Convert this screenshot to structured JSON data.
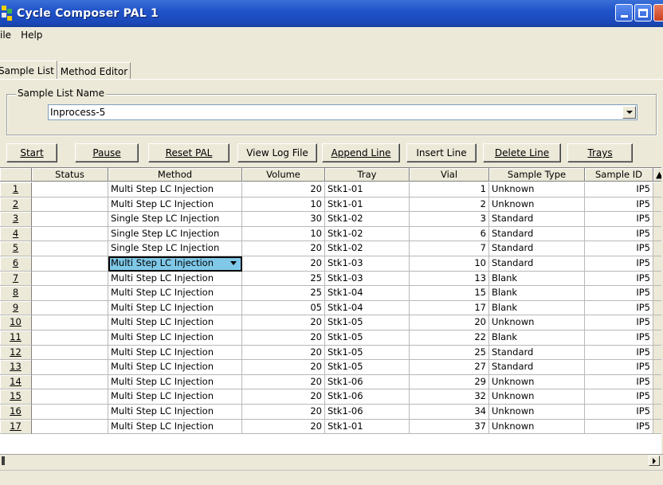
{
  "window": {
    "title": "Cycle Composer  PAL 1"
  },
  "menu": [
    "ile",
    "Help"
  ],
  "tabs": [
    {
      "label": "Sample List",
      "active": true
    },
    {
      "label": "Method Editor",
      "active": false
    }
  ],
  "sample_list_name": {
    "legend": "Sample List Name",
    "value": "Inprocess-5"
  },
  "toolbar": {
    "start": "Start",
    "pause": "Pause",
    "reset": "Reset PAL",
    "view_log": "View Log File",
    "append": "Append Line",
    "insert": "Insert Line",
    "delete": "Delete Line",
    "trays": "Trays"
  },
  "columns": [
    "Status",
    "Method",
    "Volume",
    "Tray",
    "Vial",
    "Sample Type",
    "Sample ID"
  ],
  "rows": [
    {
      "n": "1",
      "status": "",
      "method": "Multi Step LC Injection",
      "volume": "20",
      "tray": "Stk1-01",
      "vial": "1",
      "type": "Unknown",
      "sid": "IP5"
    },
    {
      "n": "2",
      "status": "",
      "method": "Multi Step LC Injection",
      "volume": "10",
      "tray": "Stk1-01",
      "vial": "2",
      "type": "Unknown",
      "sid": "IP5"
    },
    {
      "n": "3",
      "status": "",
      "method": "Single Step LC Injection",
      "volume": "30",
      "tray": "Stk1-02",
      "vial": "3",
      "type": "Standard",
      "sid": "IP5"
    },
    {
      "n": "4",
      "status": "",
      "method": "Single Step LC Injection",
      "volume": "10",
      "tray": "Stk1-02",
      "vial": "6",
      "type": "Standard",
      "sid": "IP5"
    },
    {
      "n": "5",
      "status": "",
      "method": "Single Step LC Injection",
      "volume": "20",
      "tray": "Stk1-02",
      "vial": "7",
      "type": "Standard",
      "sid": "IP5"
    },
    {
      "n": "6",
      "status": "",
      "method": "Multi Step LC Injection",
      "volume": "20",
      "tray": "Stk1-03",
      "vial": "10",
      "type": "Standard",
      "sid": "IP5",
      "editing": true
    },
    {
      "n": "7",
      "status": "",
      "method": "Multi Step LC Injection",
      "volume": "25",
      "tray": "Stk1-03",
      "vial": "13",
      "type": "Blank",
      "sid": "IP5"
    },
    {
      "n": "8",
      "status": "",
      "method": "Multi Step LC Injection",
      "volume": "25",
      "tray": "Stk1-04",
      "vial": "15",
      "type": "Blank",
      "sid": "IP5"
    },
    {
      "n": "9",
      "status": "",
      "method": "Multi Step LC Injection",
      "volume": "05",
      "tray": "Stk1-04",
      "vial": "17",
      "type": "Blank",
      "sid": "IP5"
    },
    {
      "n": "10",
      "status": "",
      "method": "Multi Step LC Injection",
      "volume": "20",
      "tray": "Stk1-05",
      "vial": "20",
      "type": "Unknown",
      "sid": "IP5"
    },
    {
      "n": "11",
      "status": "",
      "method": "Multi Step LC Injection",
      "volume": "20",
      "tray": "Stk1-05",
      "vial": "22",
      "type": "Blank",
      "sid": "IP5"
    },
    {
      "n": "12",
      "status": "",
      "method": "Multi Step LC Injection",
      "volume": "20",
      "tray": "Stk1-05",
      "vial": "25",
      "type": "Standard",
      "sid": "IP5"
    },
    {
      "n": "13",
      "status": "",
      "method": "Multi Step LC Injection",
      "volume": "20",
      "tray": "Stk1-05",
      "vial": "27",
      "type": "Standard",
      "sid": "IP5"
    },
    {
      "n": "14",
      "status": "",
      "method": "Multi Step LC Injection",
      "volume": "20",
      "tray": "Stk1-06",
      "vial": "29",
      "type": "Unknown",
      "sid": "IP5"
    },
    {
      "n": "15",
      "status": "",
      "method": "Multi Step LC Injection",
      "volume": "20",
      "tray": "Stk1-06",
      "vial": "32",
      "type": "Unknown",
      "sid": "IP5"
    },
    {
      "n": "16",
      "status": "",
      "method": "Multi Step LC Injection",
      "volume": "20",
      "tray": "Stk1-06",
      "vial": "34",
      "type": "Unknown",
      "sid": "IP5"
    },
    {
      "n": "17",
      "status": "",
      "method": "Multi Step LC Injection",
      "volume": "20",
      "tray": "Stk1-01",
      "vial": "37",
      "type": "Unknown",
      "sid": "IP5"
    }
  ],
  "colors": {
    "titlebar": "#2153c9",
    "editing_cell": "#7fc8e8",
    "face": "#ece9d8"
  }
}
